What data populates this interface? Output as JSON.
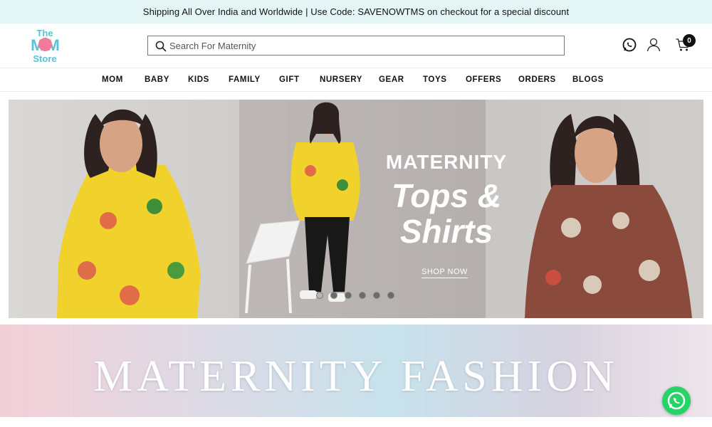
{
  "announcement": "Shipping All Over India and Worldwide | Use Code: SAVENOWTMS on checkout for a special discount",
  "logo": {
    "line1": "The",
    "line2": "M  M",
    "line3": "Store"
  },
  "search": {
    "placeholder": "Search For Maternity",
    "value": ""
  },
  "header_icons": [
    "whatsapp-icon",
    "user-icon",
    "cart-icon"
  ],
  "cart": {
    "count": "0"
  },
  "nav": [
    "MOM",
    "BABY",
    "KIDS",
    "FAMILY",
    "GIFT",
    "NURSERY",
    "GEAR",
    "TOYS",
    "OFFERS",
    "ORDERS",
    "BLOGS"
  ],
  "hero": {
    "title_line1": "MATERNITY",
    "title_line2": "Tops &",
    "title_line3": "Shirts",
    "cta": "SHOP NOW",
    "slides_total": 6,
    "active_slide": 1
  },
  "banner": {
    "text": "MATERNITY FASHION"
  },
  "colors": {
    "accent": "#57c3d7",
    "brand_pink": "#f27b9b",
    "announcement_bg": "#e3f5f5",
    "whatsapp": "#25d366"
  }
}
